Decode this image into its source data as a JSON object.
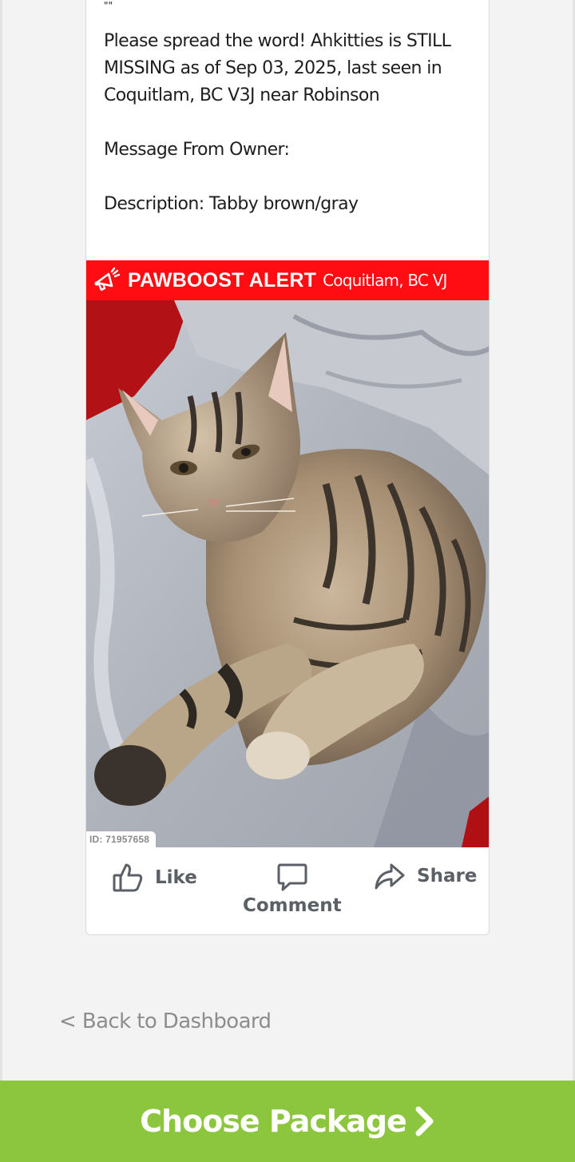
{
  "post": {
    "quote_marks": "\"\"",
    "paragraph1": "Please spread the word! Ahkitties is STILL MISSING as of Sep 03, 2025, last seen in Coquitlam, BC V3J near Robinson",
    "paragraph2": "Message From Owner:",
    "paragraph3": "Description: Tabby brown/gray"
  },
  "banner": {
    "brand": "PAWBOOST ALERT",
    "location": "Coquitlam, BC VJ",
    "color": "#ff0d12"
  },
  "photo": {
    "id_label": "ID: 71957658"
  },
  "actions": {
    "like": "Like",
    "comment": "Comment",
    "share": "Share"
  },
  "nav": {
    "back": "< Back to Dashboard"
  },
  "cta": {
    "label": "Choose Package",
    "color": "#8cc63f"
  },
  "icons": [
    "megaphone-icon",
    "thumbs-up-icon",
    "comment-bubble-icon",
    "share-arrow-icon",
    "chevron-right-icon"
  ]
}
